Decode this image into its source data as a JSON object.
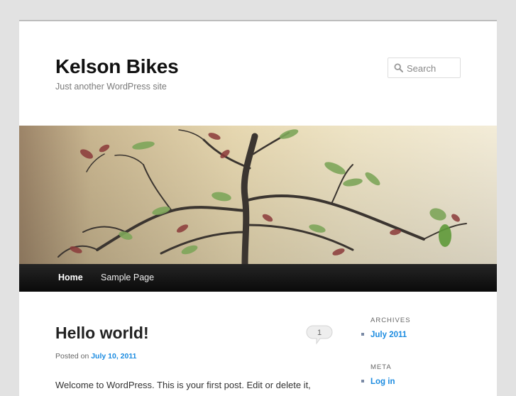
{
  "header": {
    "site_title": "Kelson Bikes",
    "site_description": "Just another WordPress site"
  },
  "search": {
    "placeholder": "Search",
    "icon": "search-icon"
  },
  "nav": {
    "items": [
      {
        "label": "Home",
        "current": true
      },
      {
        "label": "Sample Page",
        "current": false
      }
    ]
  },
  "post": {
    "title": "Hello world!",
    "comment_count": "1",
    "posted_on_label": "Posted on",
    "date": "July 10, 2011",
    "excerpt": "Welcome to WordPress. This is your first post. Edit or delete it,"
  },
  "sidebar": {
    "archives": {
      "title": "ARCHIVES",
      "items": [
        "July 2011"
      ]
    },
    "meta": {
      "title": "META",
      "items": [
        "Log in"
      ]
    }
  },
  "colors": {
    "link": "#1b8be0",
    "nav_background": "#222222",
    "page_background": "#e2e2e2"
  }
}
